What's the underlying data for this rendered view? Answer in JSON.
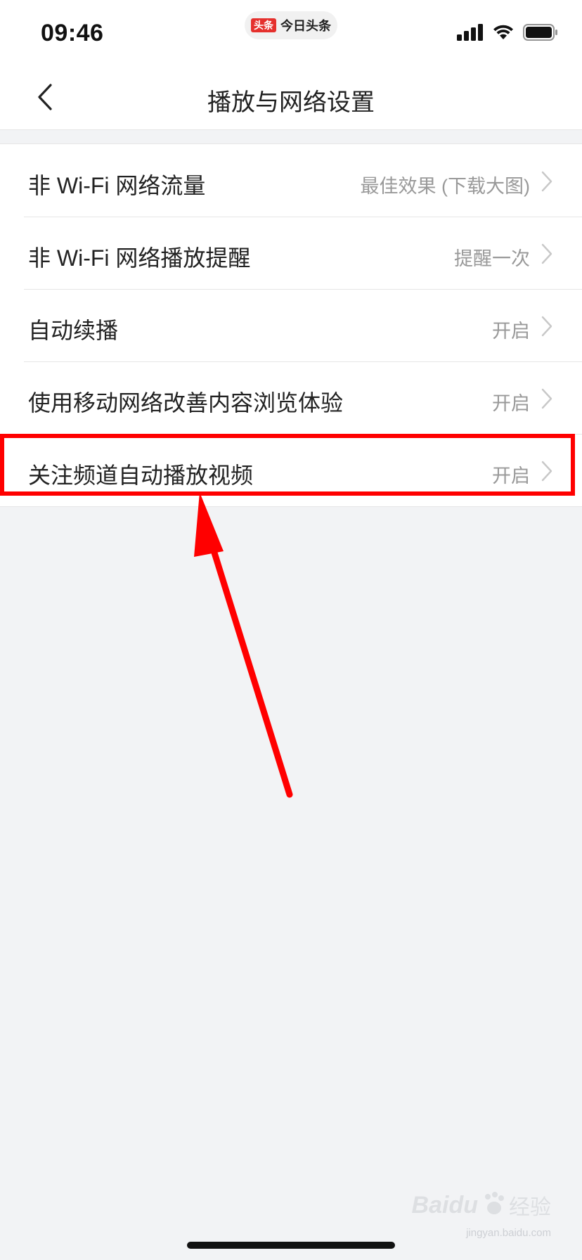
{
  "status_bar": {
    "time": "09:46",
    "app_badge": "头条",
    "app_name": "今日头条",
    "icons": [
      "cellular-signal-icon",
      "wifi-icon",
      "battery-icon"
    ]
  },
  "nav": {
    "back_icon": "chevron-left-icon",
    "title": "播放与网络设置"
  },
  "settings": [
    {
      "label": "非 Wi-Fi 网络流量",
      "value": "最佳效果 (下载大图)"
    },
    {
      "label": "非 Wi-Fi 网络播放提醒",
      "value": "提醒一次"
    },
    {
      "label": "自动续播",
      "value": "开启"
    },
    {
      "label": "使用移动网络改善内容浏览体验",
      "value": "开启"
    },
    {
      "label": "关注频道自动播放视频",
      "value": "开启"
    }
  ],
  "annotation": {
    "highlight_color": "#ff0000"
  },
  "watermark": {
    "brand": "Baidu",
    "product": "经验",
    "url": "jingyan.baidu.com"
  }
}
